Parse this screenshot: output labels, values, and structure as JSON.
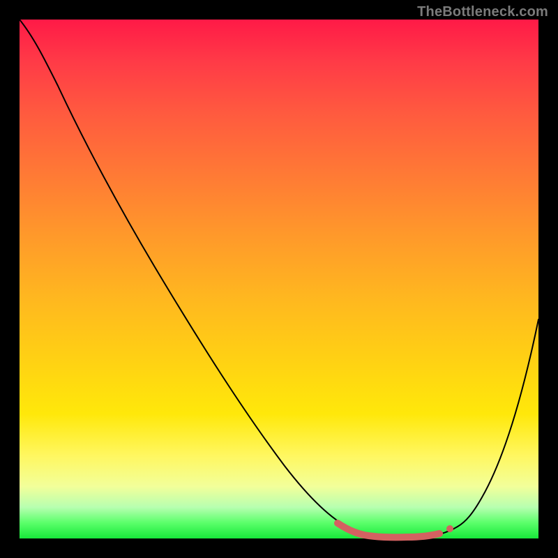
{
  "watermark": "TheBottleneck.com",
  "colors": {
    "background": "#000000",
    "curve": "#000000",
    "mark": "#d46161",
    "gradient_top": "#ff1a47",
    "gradient_bottom": "#17e83a"
  },
  "chart_data": {
    "type": "line",
    "title": "",
    "xlabel": "",
    "ylabel": "",
    "xlim": [
      0,
      100
    ],
    "ylim": [
      0,
      100
    ],
    "grid": false,
    "legend": false,
    "series": [
      {
        "name": "bottleneck-curve",
        "x": [
          0,
          5,
          10,
          15,
          20,
          25,
          30,
          35,
          40,
          45,
          50,
          55,
          60,
          63,
          66,
          70,
          74,
          78,
          82,
          85,
          88,
          92,
          96,
          100
        ],
        "y": [
          100,
          96,
          91,
          84,
          76,
          68,
          60,
          52,
          44,
          35,
          26,
          18,
          11,
          6,
          3,
          1,
          0,
          0,
          1,
          3,
          8,
          17,
          30,
          45
        ]
      }
    ],
    "highlight_region": {
      "name": "optimal-range",
      "x": [
        62,
        80
      ],
      "y_approx": 2,
      "note": "Flat valley of the curve marked with thick reddish polyline and dot"
    }
  }
}
